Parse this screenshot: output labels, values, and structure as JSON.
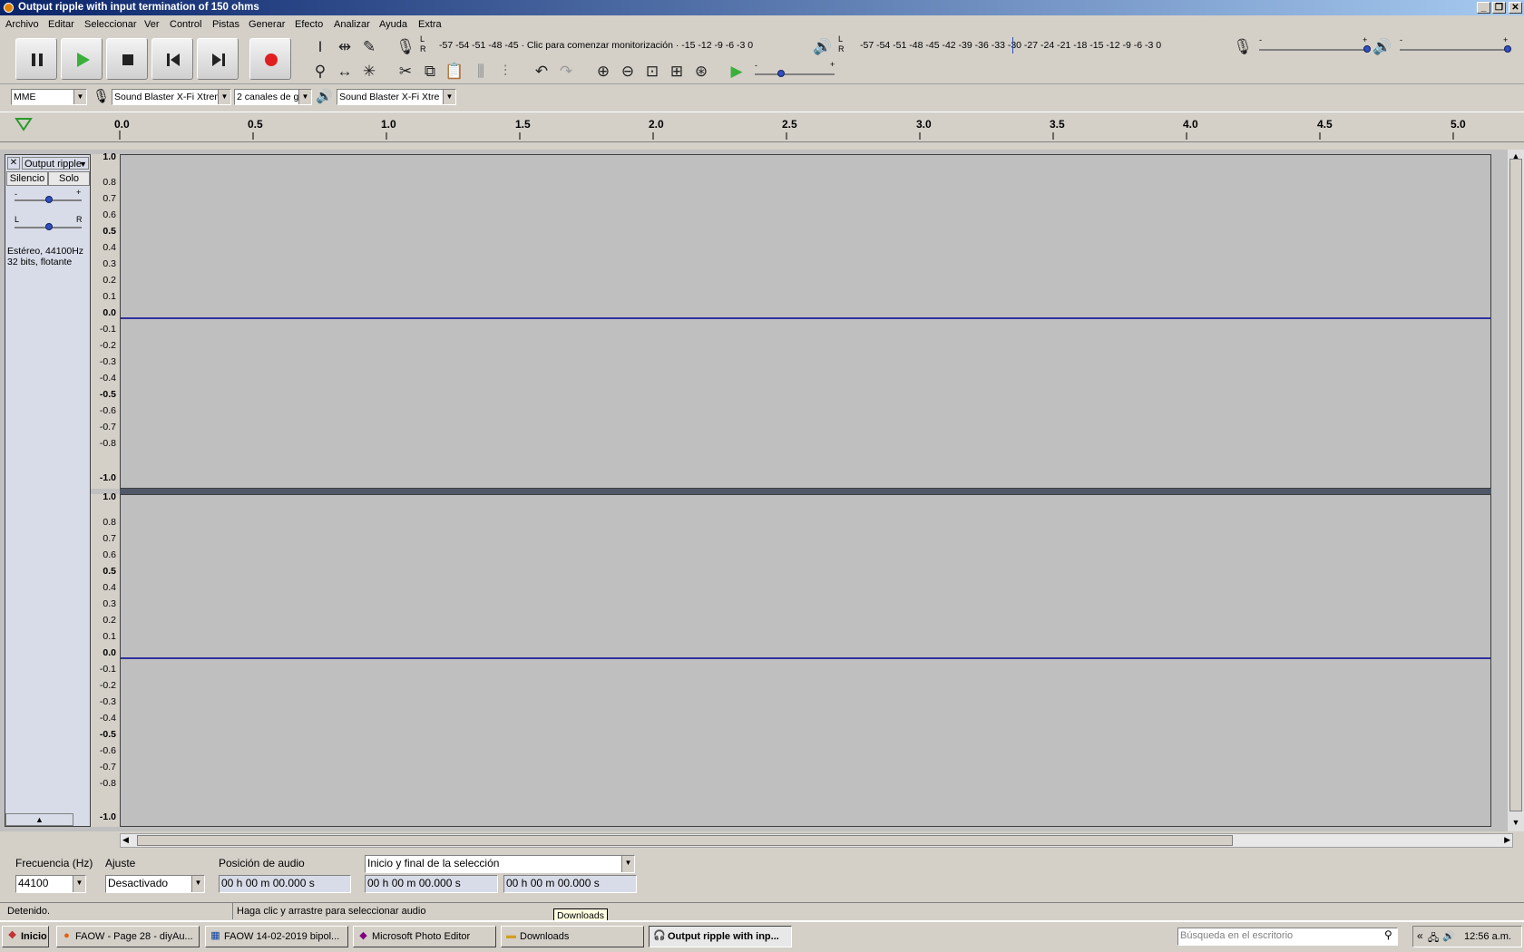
{
  "window": {
    "title": "Output ripple with input termination of 150 ohms",
    "min": "_",
    "max": "❐",
    "close": "✕"
  },
  "menu": [
    "Archivo",
    "Editar",
    "Seleccionar",
    "Ver",
    "Control",
    "Pistas",
    "Generar",
    "Efecto",
    "Analizar",
    "Ayuda",
    "Extra"
  ],
  "meters": {
    "record_scale": "-57 -54 -51 -48 -45 · Clic para comenzar monitorización · -15 -12 -9 -6 -3 0",
    "play_scale": "-57 -54 -51 -48 -45 -42 -39 -36 -33 -30 -27 -24 -21 -18 -15 -12 -9 -6 -3 0",
    "lr_top": "L",
    "lr_bottom": "R",
    "slider_minus": "-",
    "slider_plus": "+"
  },
  "devices": {
    "host": "MME",
    "input": "Sound Blaster X-Fi Xtrem",
    "channels": "2 canales de g",
    "output": "Sound Blaster X-Fi Xtre"
  },
  "ruler": [
    "0.0",
    "0.5",
    "1.0",
    "1.5",
    "2.0",
    "2.5",
    "3.0",
    "3.5",
    "4.0",
    "4.5",
    "5.0"
  ],
  "track": {
    "name": "Output ripple",
    "mute": "Silencio",
    "solo": "Solo",
    "gain_minus": "-",
    "gain_plus": "+",
    "pan_left": "L",
    "pan_right": "R",
    "info1": "Estéreo, 44100Hz",
    "info2": "32 bits, flotante",
    "collapse": "▲",
    "close": "✕"
  },
  "vscale": [
    "1.0",
    "0.8",
    "0.7",
    "0.6",
    "0.5",
    "0.4",
    "0.3",
    "0.2",
    "0.1",
    "0.0",
    "-0.1",
    "-0.2",
    "-0.3",
    "-0.4",
    "-0.5",
    "-0.6",
    "-0.7",
    "-0.8",
    "-1.0"
  ],
  "selection": {
    "rate_label": "Frecuencia (Hz)",
    "rate_value": "44100",
    "snap_label": "Ajuste",
    "snap_value": "Desactivado",
    "pos_label": "Posición de audio",
    "pos_value": "00 h 00 m 00.000 s",
    "mode_value": "Inicio y final de la selección",
    "start_value": "00 h 00 m 00.000 s",
    "end_value": "00 h 00 m 00.000 s"
  },
  "status": {
    "left": "Detenido.",
    "hint": "Haga clic y arrastre para seleccionar audio",
    "tooltip": "Downloads"
  },
  "taskbar": {
    "start": "Inicio",
    "items": [
      "FAOW - Page 28 - diyAu...",
      "FAOW 14-02-2019 bipol...",
      "Microsoft Photo Editor",
      "Downloads",
      "Output ripple with inp..."
    ],
    "search_placeholder": "Búsqueda en el escritorio",
    "chevrons": "«",
    "clock": "12:56 a.m."
  }
}
